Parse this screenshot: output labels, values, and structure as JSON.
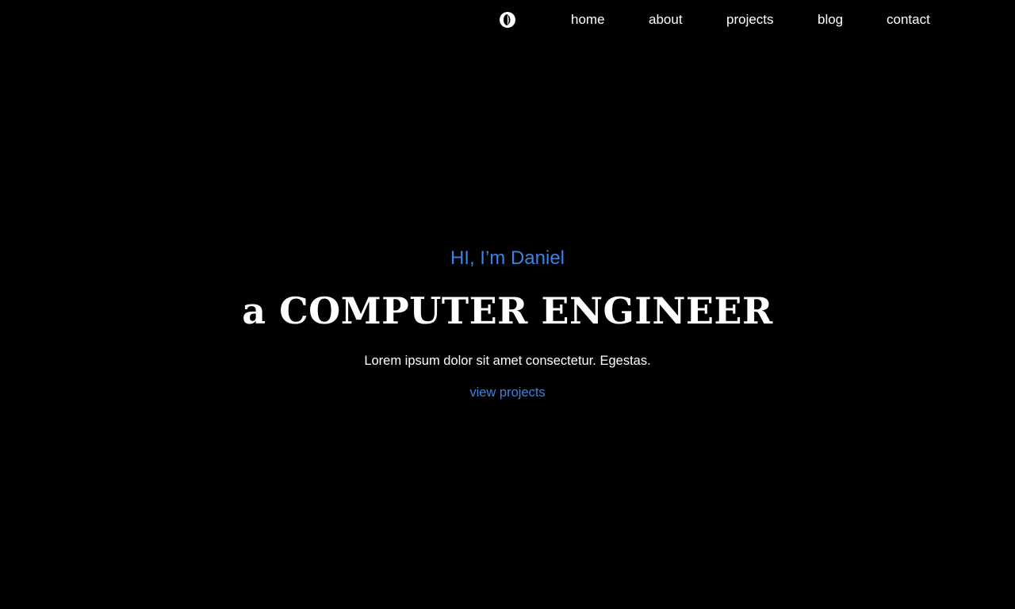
{
  "nav": {
    "logo_icon": "contrast-toggle-icon",
    "links": [
      {
        "label": "home"
      },
      {
        "label": "about"
      },
      {
        "label": "projects"
      },
      {
        "label": "blog"
      },
      {
        "label": "contact"
      }
    ]
  },
  "hero": {
    "greeting": "HI, I’m Daniel",
    "headline": "a COMPUTER ENGINEER",
    "tagline": "Lorem ipsum dolor sit amet consectetur. Egestas.",
    "cta_label": "view projects"
  },
  "colors": {
    "background": "#000000",
    "text": "#ffffff",
    "accent": "#3b82e6"
  }
}
